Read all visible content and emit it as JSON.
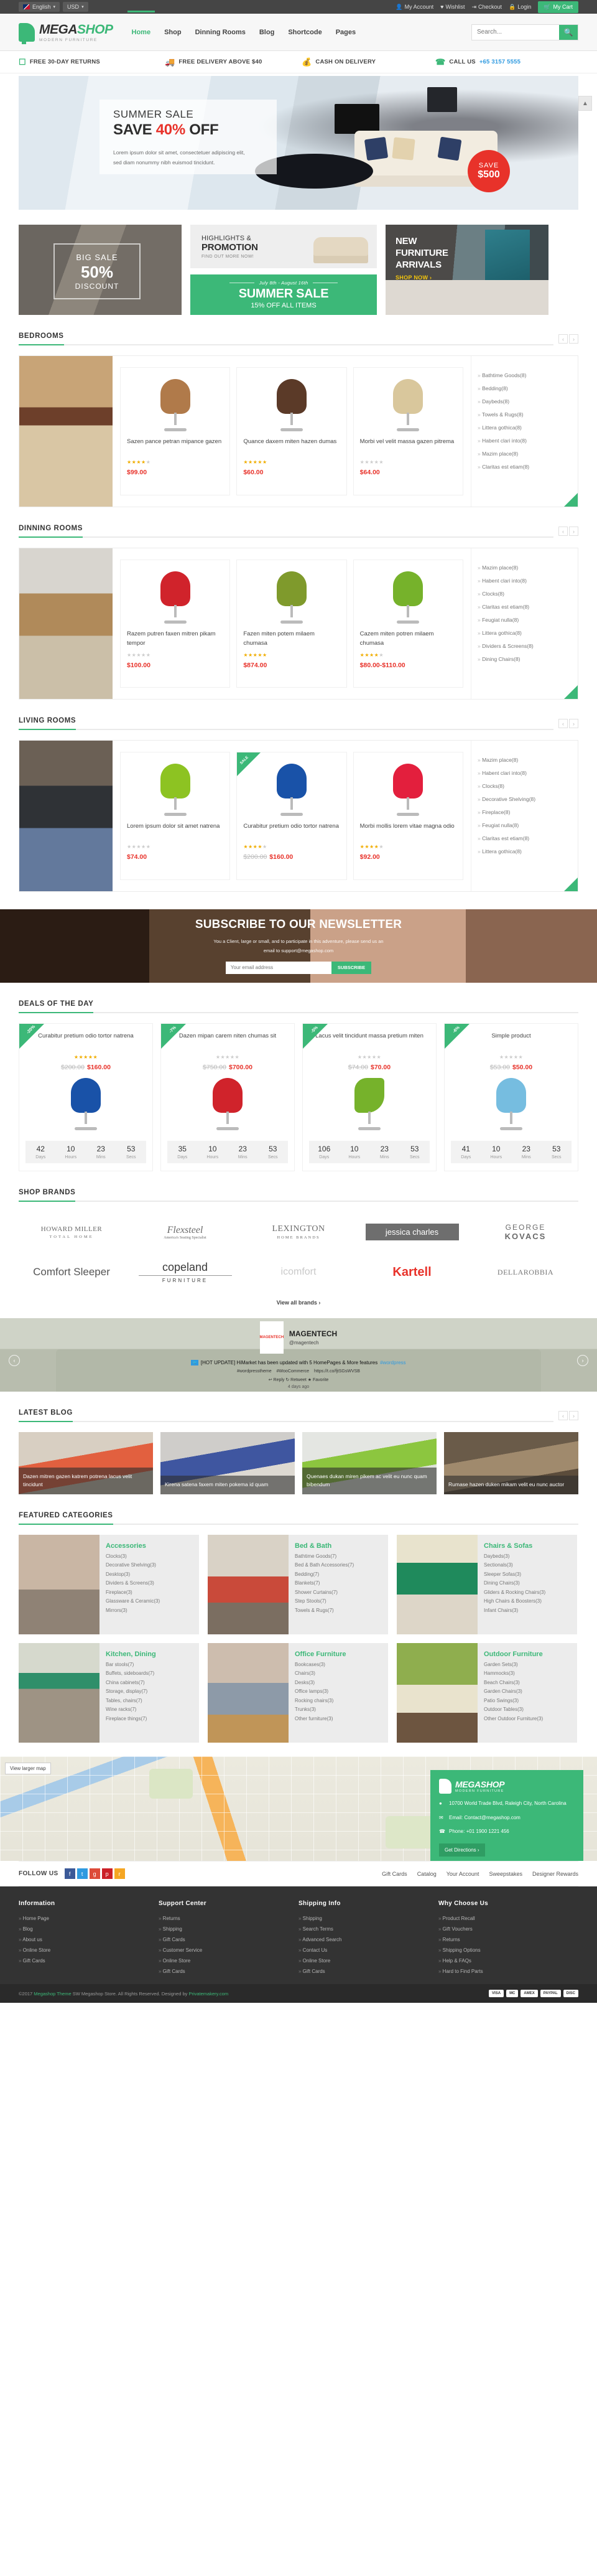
{
  "topbar": {
    "language": "English",
    "currency": "USD",
    "links": [
      {
        "label": "My Account",
        "icon": "user-icon"
      },
      {
        "label": "Wishlist",
        "icon": "heart-icon"
      },
      {
        "label": "Checkout",
        "icon": "arrow-icon"
      },
      {
        "label": "Login",
        "icon": "lock-icon"
      }
    ],
    "cart_label": "My Cart"
  },
  "header": {
    "logo_main": "MEGA",
    "logo_accent": "SHOP",
    "logo_sub": "MODERN FURNITURE",
    "nav": [
      {
        "label": "Home",
        "active": true
      },
      {
        "label": "Shop",
        "active": false
      },
      {
        "label": "Dinning Rooms",
        "active": false
      },
      {
        "label": "Blog",
        "active": false
      },
      {
        "label": "Shortcode",
        "active": false
      },
      {
        "label": "Pages",
        "active": false
      }
    ],
    "search_placeholder": "Search..."
  },
  "services": [
    {
      "label": "FREE 30-DAY RETURNS",
      "icon": "return-box-icon"
    },
    {
      "label": "FREE DELIVERY ABOVE $40",
      "icon": "truck-icon"
    },
    {
      "label": "CASH ON DELIVERY",
      "icon": "money-bag-icon"
    },
    {
      "label": "CALL US",
      "phone": "+65 3157 5555",
      "icon": "phone-icon"
    }
  ],
  "hero": {
    "kicker": "SUMMER SALE",
    "title_a": "SAVE ",
    "title_pct": "40%",
    "title_b": " OFF",
    "desc_line1": "Lorem ipsum dolor sit amet, consectetuer adipiscing elit,",
    "desc_line2": "sed diam nonummy nibh euismod tincidunt.",
    "badge_line1": "SAVE",
    "badge_line2": "$500"
  },
  "promos": {
    "left": {
      "line1": "BIG SALE",
      "line2": "50%",
      "line3": "DISCOUNT"
    },
    "highlights": {
      "line1": "HIGHLIGHTS &",
      "line2": "PROMOTION",
      "line3": "FIND OUT MORE NOW!"
    },
    "summer": {
      "dates": "July 8th - August 16th",
      "title": "SUMMER SALE",
      "sub": "15% OFF ALL ITEMS"
    },
    "right": {
      "line1": "NEW",
      "line2": "FURNITURE",
      "line3": "ARRIVALS",
      "cta": "SHOP NOW ›"
    }
  },
  "sections": [
    {
      "title": "BEDROOMS",
      "products": [
        {
          "name": "Sazen pance petran mipance gazen",
          "stars": 4,
          "price": "$99.00",
          "old_price": "",
          "sale": false,
          "color": "#b07a4a"
        },
        {
          "name": "Quance daxem miten hazen dumas",
          "stars": 5,
          "price": "$60.00",
          "old_price": "",
          "sale": false,
          "color": "#5b3a28"
        },
        {
          "name": "Morbi vel velit massa gazen pitrema",
          "stars": 0,
          "price": "$64.00",
          "old_price": "",
          "sale": false,
          "color": "#d9c79c"
        }
      ],
      "categories": [
        "Bathtime Goods(8)",
        "Bedding(8)",
        "Daybeds(8)",
        "Towels & Rugs(8)",
        "Littera gothica(8)",
        "Habent clari into(8)",
        "Mazim place(8)",
        "Claritas est etiam(8)"
      ]
    },
    {
      "title": "DINNING ROOMS",
      "products": [
        {
          "name": "Razem putren faxen mitren pikam tempor",
          "stars": 0,
          "price": "$100.00",
          "old_price": "",
          "sale": false,
          "color": "#d0232b"
        },
        {
          "name": "Fazen miten potem milaem chumasa",
          "stars": 5,
          "price": "$874.00",
          "old_price": "",
          "sale": false,
          "color": "#7f9a2c"
        },
        {
          "name": "Cazem miten potren milaem chumasa",
          "stars": 4,
          "price": "$80.00-$110.00",
          "old_price": "",
          "sale": false,
          "color": "#76b22b"
        }
      ],
      "categories": [
        "Mazim place(8)",
        "Habent clari into(8)",
        "Clocks(8)",
        "Claritas est etiam(8)",
        "Feugiat nulla(8)",
        "Littera gothica(8)",
        "Dividers & Screens(8)",
        "Dining Chairs(8)"
      ]
    },
    {
      "title": "LIVING ROOMS",
      "products": [
        {
          "name": "Lorem ipsum dolor sit amet natrena",
          "stars": 0,
          "price": "$74.00",
          "old_price": "",
          "sale": false,
          "color": "#8dc322"
        },
        {
          "name": "Curabitur pretium odio tortor natrena",
          "stars": 4,
          "price": "$160.00",
          "old_price": "$200.00",
          "sale": true,
          "sale_label": "SALE",
          "color": "#1952a8"
        },
        {
          "name": "Morbi mollis lorem vitae magna odio",
          "stars": 4,
          "price": "$92.00",
          "old_price": "",
          "sale": false,
          "color": "#e31f3d"
        }
      ],
      "categories": [
        "Mazim place(8)",
        "Habent clari into(8)",
        "Clocks(8)",
        "Decorative Shelving(8)",
        "Fireplace(8)",
        "Feugiat nulla(8)",
        "Claritas est etiam(8)",
        "Littera gothica(8)"
      ]
    }
  ],
  "newsletter": {
    "title": "SUBSCRIBE TO OUR NEWSLETTER",
    "desc_line1": "You a Client, large or small, and to participate in this adventure, please send us an",
    "desc_line2": "email to support@megashop.com",
    "placeholder": "Your email address",
    "button": "SUBSCRIBE"
  },
  "deals": {
    "title": "DEALS OF THE DAY",
    "timer_labels": [
      "Days",
      "Hours",
      "Mins",
      "Secs"
    ],
    "items": [
      {
        "discount": "-20%",
        "name": "Curabitur pretium odio tortor natrena",
        "stars": 5,
        "old_price": "$200.00",
        "price": "$160.00",
        "color": "#1952a8",
        "timer": [
          "42",
          "10",
          "23",
          "53"
        ]
      },
      {
        "discount": "-7%",
        "name": "Dazen mipan carem niten chumas sit",
        "stars": 0,
        "old_price": "$750.00",
        "price": "$700.00",
        "color": "#d0232b",
        "timer": [
          "35",
          "10",
          "23",
          "53"
        ]
      },
      {
        "discount": "-5%",
        "name": "Lacus velit tincidunt massa pretium miten",
        "stars": 0,
        "old_price": "$74.00",
        "price": "$70.00",
        "color": "#76b22b",
        "timer": [
          "106",
          "10",
          "23",
          "53"
        ]
      },
      {
        "discount": "-6%",
        "name": "Simple product",
        "stars": 0,
        "old_price": "$53.00",
        "price": "$50.00",
        "color": "#76bde0",
        "timer": [
          "41",
          "10",
          "23",
          "53"
        ]
      }
    ]
  },
  "brands": {
    "title": "SHOP BRANDS",
    "row1": [
      {
        "name": "HOWARD MILLER",
        "sub": "TOTAL HOME"
      },
      {
        "name": "Flexsteel",
        "sub": "America's Seating Specialist"
      },
      {
        "name": "LEXINGTON",
        "sub": "HOME BRANDS"
      },
      {
        "name": "jessica charles",
        "sub": ""
      },
      {
        "name": "GEORGE",
        "sub": "KOVACS"
      }
    ],
    "row2": [
      {
        "name": "Comfort Sleeper",
        "sub": ""
      },
      {
        "name": "copeland",
        "sub": "FURNITURE"
      },
      {
        "name": "icomfort",
        "sub": "Sleep System by Serta"
      },
      {
        "name": "Kartell",
        "sub": ""
      },
      {
        "name": "DELLAROBBIA",
        "sub": ""
      }
    ],
    "view_all": "View all brands ›"
  },
  "twitter": {
    "name": "MAGENTECH",
    "handle": "@magentech",
    "logo_text": "MAGENTECH",
    "message": "[HOT UPDATE] HiMarket has been updated with 5 HomePages & More features",
    "hashtag": "#wordpress",
    "meta": [
      "#wordpresstheme",
      "#WooCommerce",
      "https://t.co/fjtSGsWVSB"
    ],
    "actions": "↩ Reply  ↻ Retweet  ★ Favorite",
    "date": "4 days ago"
  },
  "blog": {
    "title": "LATEST BLOG",
    "posts": [
      {
        "title": "Dazen mitren gazen katrem potrena lacus velit tincidunt"
      },
      {
        "title": "Kirena satena faxem miten pokema id quam"
      },
      {
        "title": "Quenaes dukan miren pikem ac velit eu nunc quam bibendum"
      },
      {
        "title": "Rumase hazen duken mikam velit eu nunc auctor"
      }
    ]
  },
  "featured": {
    "title": "FEATURED CATEGORIES",
    "cards": [
      {
        "title": "Accessories",
        "img": "im-acc",
        "items": [
          "Clocks(3)",
          "Decorative Shelving(3)",
          "Desktop(3)",
          "Dividers & Screens(3)",
          "Fireplace(3)",
          "Glassware & Ceramic(3)",
          "Mirrors(3)"
        ]
      },
      {
        "title": "Bed & Bath",
        "img": "im-bed",
        "items": [
          "Bathtime Goods(7)",
          "Bed & Bath Accessories(7)",
          "Bedding(7)",
          "Blankets(7)",
          "Shower Curtains(7)",
          "Step Stools(7)",
          "Towels & Rugs(7)"
        ]
      },
      {
        "title": "Chairs & Sofas",
        "img": "im-cha",
        "items": [
          "Daybeds(3)",
          "Sectionals(3)",
          "Sleeper Sofas(3)",
          "Dining Chairs(3)",
          "Gliders & Rocking Chairs(3)",
          "High Chairs & Boosters(3)",
          "Infant Chairs(3)"
        ]
      },
      {
        "title": "Kitchen, Dining",
        "img": "im-kit",
        "items": [
          "Bar stools(7)",
          "Buffets, sideboards(7)",
          "China cabinets(7)",
          "Storage, display(7)",
          "Tables, chairs(7)",
          "Wine racks(7)",
          "Fireplace things(7)"
        ]
      },
      {
        "title": "Office Furniture",
        "img": "im-off",
        "items": [
          "Bookcases(3)",
          "Chairs(3)",
          "Desks(3)",
          "Office lamps(3)",
          "Rocking chairs(3)",
          "Trunks(3)",
          "Other furniture(3)"
        ]
      },
      {
        "title": "Outdoor Furniture",
        "img": "im-out",
        "items": [
          "Garden Sets(3)",
          "Hammocks(3)",
          "Beach Chairs(3)",
          "Garden Chairs(3)",
          "Patio Swings(3)",
          "Outdoor Tables(3)",
          "Other Outdoor Furniture(3)"
        ]
      }
    ]
  },
  "map": {
    "view_larger": "View larger map",
    "contact": {
      "name_main": "MEGASHOP",
      "name_sub": "MODERN FURNITURE",
      "address": "10700 World Trade Blvd, Raleigh City, North Carolina",
      "email": "Email: Contact@megashop.com",
      "phone": "Phone: +01 1900 1221 456",
      "button": "Get Directions ›"
    }
  },
  "follow": {
    "label": "FOLLOW US",
    "socials": [
      "facebook-icon",
      "twitter-icon",
      "google-plus-icon",
      "pinterest-icon",
      "rss-icon"
    ],
    "links": [
      "Gift Cards",
      "Catalog",
      "Your Account",
      "Sweepstakes",
      "Designer Rewards"
    ]
  },
  "footer": {
    "columns": [
      {
        "heading": "Information",
        "items": [
          "Home Page",
          "Blog",
          "About us",
          "Online Store",
          "Gift Cards"
        ]
      },
      {
        "heading": "Support Center",
        "items": [
          "Returns",
          "Shipping",
          "Gift Cards",
          "Customer Service",
          "Online Store",
          "Gift Cards"
        ]
      },
      {
        "heading": "Shipping Info",
        "items": [
          "Shipping",
          "Search Terms",
          "Advanced Search",
          "Contact Us",
          "Online Store",
          "Gift Cards"
        ]
      },
      {
        "heading": "Why Choose Us",
        "items": [
          "Product Recall",
          "Gift Vouchers",
          "Returns",
          "Shipping Options",
          "Help & FAQs",
          "Hard to Find Parts"
        ]
      }
    ]
  },
  "copyright": {
    "text_a": "©2017 ",
    "link_a": "Megashop Theme",
    "text_b": " SW Megashop Store. All Rights Reserved. Designed by ",
    "link_b": "Privatemakery.com",
    "payments": [
      "VISA",
      "MC",
      "AMEX",
      "PAYPAL",
      "DISC"
    ]
  }
}
